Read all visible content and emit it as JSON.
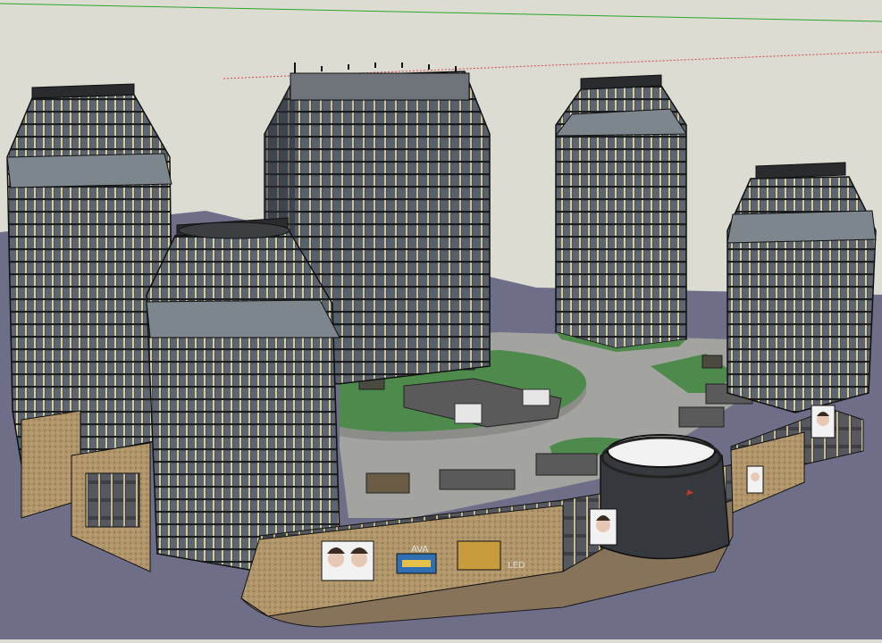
{
  "scene": {
    "colors": {
      "sky": "#dcdcd2",
      "ground": "#6e6e88",
      "plaza": "#a3a3a0",
      "lawn": "#4d8a4c",
      "tower_glass": "#4f5660",
      "tower_frame": "#1c1d1f",
      "tower_accent": "#c8b98a",
      "podium_stone": "#b89c6a",
      "green_axis": "#2ea52e",
      "red_axis": "#d04848"
    },
    "icons": {
      "billboard_face": "portrait-billboard-icon",
      "sign": "shop-sign-icon"
    },
    "signage": {
      "podium_sign_1": "AVA",
      "podium_sign_2": "LED"
    }
  }
}
